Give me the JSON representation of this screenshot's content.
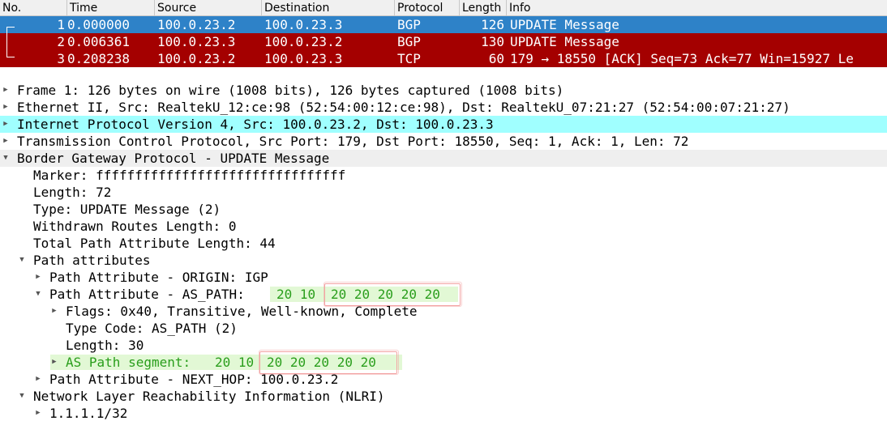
{
  "packet_list": {
    "columns": [
      "No.",
      "Time",
      "Source",
      "Destination",
      "Protocol",
      "Length",
      "Info"
    ],
    "rows": [
      {
        "no": "1",
        "time": "0.000000",
        "src": "100.0.23.2",
        "dst": "100.0.23.3",
        "proto": "BGP",
        "len": "126",
        "info": "UPDATE Message"
      },
      {
        "no": "2",
        "time": "0.006361",
        "src": "100.0.23.3",
        "dst": "100.0.23.2",
        "proto": "BGP",
        "len": "130",
        "info": "UPDATE Message"
      },
      {
        "no": "3",
        "time": "0.208238",
        "src": "100.0.23.2",
        "dst": "100.0.23.3",
        "proto": "TCP",
        "len": "60",
        "info": "179 → 18550 [ACK] Seq=73 Ack=77 Win=15927 Le"
      }
    ]
  },
  "details": {
    "frame": "Frame 1: 126 bytes on wire (1008 bits), 126 bytes captured (1008 bits)",
    "ethernet": "Ethernet II, Src: RealtekU_12:ce:98 (52:54:00:12:ce:98), Dst: RealtekU_07:21:27 (52:54:00:07:21:27)",
    "ip": "Internet Protocol Version 4, Src: 100.0.23.2, Dst: 100.0.23.3",
    "tcp": "Transmission Control Protocol, Src Port: 179, Dst Port: 18550, Seq: 1, Ack: 1, Len: 72",
    "bgp": "Border Gateway Protocol - UPDATE Message",
    "marker": "Marker: ffffffffffffffffffffffffffffffff",
    "length": "Length: 72",
    "type": "Type: UPDATE Message (2)",
    "withdrawn": "Withdrawn Routes Length: 0",
    "total_path": "Total Path Attribute Length: 44",
    "path_attrs": "Path attributes",
    "origin": "Path Attribute - ORIGIN: IGP",
    "as_path_label": "Path Attribute - AS_PATH:",
    "as_path_prefix": "20 10",
    "as_path_repeat": "20 20 20 20 20",
    "flags": "Flags: 0x40, Transitive, Well-known, Complete",
    "type_code": "Type Code: AS_PATH (2)",
    "as_length": "Length: 30",
    "segment_label": "AS Path segment:",
    "segment_prefix": "20 10",
    "segment_repeat": "20 20 20 20 20",
    "next_hop": "Path Attribute - NEXT_HOP: 100.0.23.2",
    "nlri": "Network Layer Reachability Information (NLRI)",
    "prefix": "1.1.1.1/32"
  },
  "colors": {
    "selected_row": "#2e82c8",
    "protocol_row": "#a40000",
    "selected_detail": "#a0ffff",
    "highlight_text": "#2a9e1c",
    "annotation": "#f3a3a3"
  },
  "icons": {
    "collapsed": "triangle-right-icon",
    "expanded": "triangle-down-icon"
  }
}
